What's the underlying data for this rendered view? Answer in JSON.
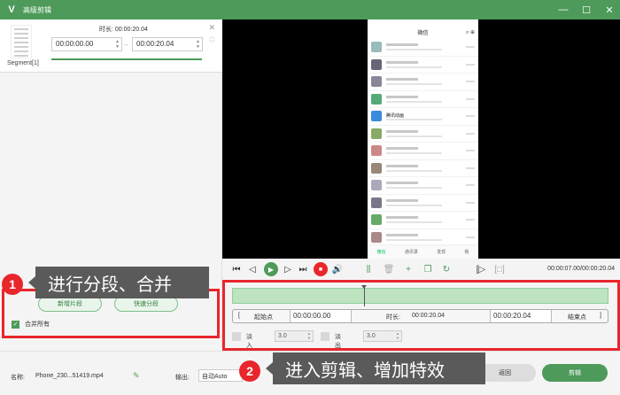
{
  "window": {
    "title": "高级剪辑",
    "logo": "V",
    "minimize": "—",
    "maximize": "☐",
    "close": "✕"
  },
  "segment": {
    "label": "Segment[1]",
    "duration_label": "时长: 00:00:20.04",
    "start_time": "00:00:00.00",
    "end_time": "00:00:20.04",
    "separator": "--"
  },
  "left_actions": {
    "new_segment": "新增片段",
    "fast_split": "快速分段",
    "merge_all": "合并所有",
    "merge_checked": true
  },
  "phone_preview": {
    "app_title": "微信",
    "chats": [
      {
        "name": "",
        "sub": "",
        "color": "#9bb"
      },
      {
        "name": "",
        "sub": "",
        "color": "#667"
      },
      {
        "name": "",
        "sub": "",
        "color": "#889"
      },
      {
        "name": "",
        "sub": "",
        "color": "#5a7"
      },
      {
        "name": "腾讯动画",
        "sub": "",
        "color": "#3a8ae0"
      },
      {
        "name": "",
        "sub": "",
        "color": "#8a6"
      },
      {
        "name": "",
        "sub": "",
        "color": "#c88"
      },
      {
        "name": "",
        "sub": "",
        "color": "#987"
      },
      {
        "name": "",
        "sub": "",
        "color": "#aab"
      },
      {
        "name": "",
        "sub": "",
        "color": "#778"
      },
      {
        "name": "",
        "sub": "",
        "color": "#6a6"
      },
      {
        "name": "",
        "sub": "",
        "color": "#a88"
      }
    ],
    "tabs": [
      "微信",
      "通讯录",
      "发现",
      "我"
    ]
  },
  "playback": {
    "time_readout": "00:00:07.00/00:00:20.04"
  },
  "timeline": {
    "start_point": "起始点",
    "start_time": "00:00:00.00",
    "duration_label": "时长:",
    "duration_value": "00:00:20.04",
    "end_time": "00:00:20.04",
    "end_point": "结束点",
    "fade_in_label": "淡入",
    "fade_in_value": "3.0",
    "fade_out_label": "淡出",
    "fade_out_value": "3.0",
    "bracket_left": "[",
    "bracket_right": "]",
    "playhead_fraction": 0.349
  },
  "bottom": {
    "name_label": "名称:",
    "file_name": "Phone_230...51419.mp4",
    "output_label": "输出:",
    "output_value": "自动Auto",
    "back": "返回",
    "cut": "剪辑"
  },
  "callouts": {
    "one_num": "1",
    "one_text": "进行分段、合并",
    "two_num": "2",
    "two_text": "进入剪辑、增加特效"
  }
}
